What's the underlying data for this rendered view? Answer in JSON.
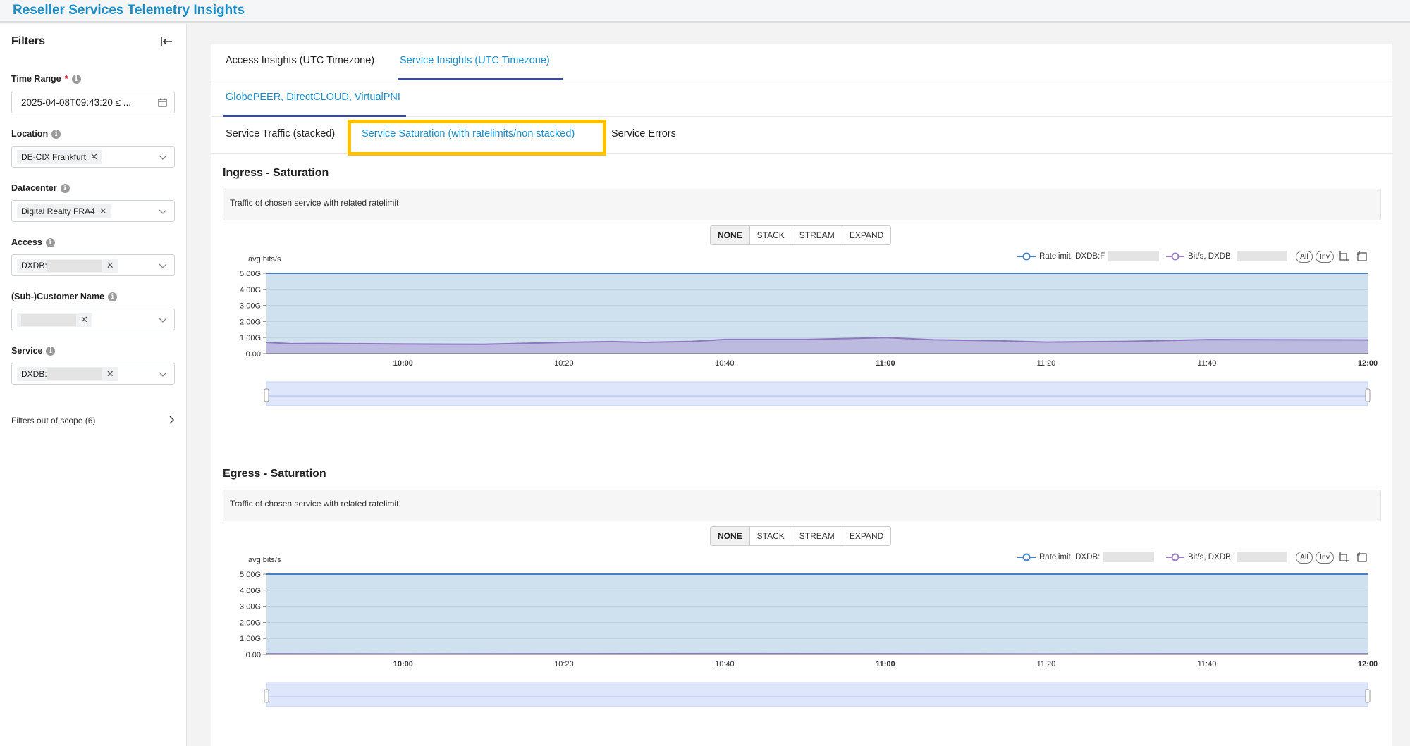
{
  "app_title": "Reseller Services Telemetry Insights",
  "sidebar": {
    "title": "Filters",
    "time_range": {
      "label": "Time Range",
      "value": "2025-04-08T09:43:20 ≤ ..."
    },
    "location": {
      "label": "Location",
      "tag": "DE-CIX Frankfurt"
    },
    "datacenter": {
      "label": "Datacenter",
      "tag": "Digital Realty FRA4"
    },
    "access": {
      "label": "Access",
      "tag_prefix": "DXDB:"
    },
    "customer": {
      "label": "(Sub-)Customer Name"
    },
    "service": {
      "label": "Service",
      "tag_prefix": "DXDB:"
    },
    "out_of_scope": "Filters out of scope (6)"
  },
  "tabs": {
    "level1": [
      "Access Insights (UTC Timezone)",
      "Service Insights (UTC Timezone)"
    ],
    "level2": [
      "GlobePEER, DirectCLOUD, VirtualPNI"
    ],
    "level3": [
      "Service Traffic (stacked)",
      "Service Saturation (with ratelimits/non stacked)",
      "Service Errors"
    ]
  },
  "stack_modes": [
    "NONE",
    "STACK",
    "STREAM",
    "EXPAND"
  ],
  "legend_pills": [
    "All",
    "Inv"
  ],
  "colors": {
    "accent": "#1a8fca",
    "ratelimit": "#4a7fbf",
    "bits": "#9a7fc4",
    "highlight": "#ffc000"
  },
  "charts": [
    {
      "title": "Ingress - Saturation",
      "description": "Traffic of chosen service with related ratelimit",
      "legend": [
        "Ratelimit, DXDB:F",
        "Bit/s, DXDB:"
      ],
      "ylabel": "avg bits/s"
    },
    {
      "title": "Egress - Saturation",
      "description": "Traffic of chosen service with related ratelimit",
      "legend": [
        "Ratelimit, DXDB:",
        "Bit/s, DXDB:"
      ],
      "ylabel": "avg bits/s"
    }
  ],
  "chart_data": [
    {
      "type": "area",
      "x_unit": "time (UTC)",
      "x_ticks": [
        "10:00",
        "10:20",
        "10:40",
        "11:00",
        "11:20",
        "11:40",
        "12:00"
      ],
      "y_ticks": [
        "5.00G",
        "4.00G",
        "3.00G",
        "2.00G",
        "1.00G",
        "0.00"
      ],
      "ylim": [
        0,
        5
      ],
      "xlim_minutes": [
        43,
        180
      ],
      "series": [
        {
          "name": "Ratelimit, DXDB:F",
          "x": [
            43,
            180
          ],
          "values": [
            5.0,
            5.0
          ]
        },
        {
          "name": "Bit/s, DXDB:",
          "x": [
            43,
            46,
            50,
            60,
            70,
            80,
            86,
            90,
            96,
            100,
            110,
            116,
            120,
            126,
            134,
            140,
            150,
            160,
            170,
            180
          ],
          "values": [
            0.7,
            0.62,
            0.63,
            0.6,
            0.58,
            0.7,
            0.75,
            0.7,
            0.76,
            0.88,
            0.88,
            0.95,
            1.0,
            0.86,
            0.8,
            0.72,
            0.76,
            0.87,
            0.86,
            0.85
          ]
        }
      ]
    },
    {
      "type": "area",
      "x_unit": "time (UTC)",
      "x_ticks": [
        "10:00",
        "10:20",
        "10:40",
        "11:00",
        "11:20",
        "11:40",
        "12:00"
      ],
      "y_ticks": [
        "5.00G",
        "4.00G",
        "3.00G",
        "2.00G",
        "1.00G",
        "0.00"
      ],
      "ylim": [
        0,
        5
      ],
      "xlim_minutes": [
        43,
        180
      ],
      "series": [
        {
          "name": "Ratelimit, DXDB:",
          "x": [
            43,
            180
          ],
          "values": [
            5.0,
            5.0
          ]
        },
        {
          "name": "Bit/s, DXDB:",
          "x": [
            43,
            60,
            80,
            100,
            120,
            140,
            160,
            180
          ],
          "values": [
            0.04,
            0.03,
            0.04,
            0.05,
            0.04,
            0.03,
            0.04,
            0.04
          ]
        }
      ]
    }
  ]
}
